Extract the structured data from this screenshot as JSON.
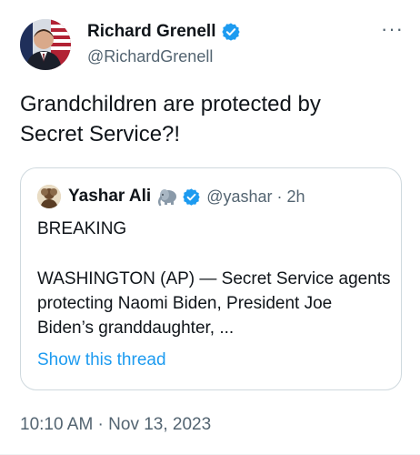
{
  "tweet": {
    "author_name": "Richard Grenell",
    "author_handle": "@RichardGrenell",
    "text": "Grandchildren are protected by Secret Service?!",
    "timestamp": "10:10 AM · Nov 13, 2023",
    "more_icon": "more-horizontal-icon"
  },
  "quote": {
    "author_name": "Yashar Ali",
    "author_handle": "@yashar",
    "separator": "·",
    "time": "2h",
    "breaking": "BREAKING",
    "body": "WASHINGTON (AP) — Secret Service agents protecting Naomi Biden, President Joe Biden’s granddaughter, ...",
    "show_thread": "Show this thread"
  },
  "colors": {
    "verified": "#1d9bf0",
    "link": "#1d9bf0",
    "secondary_text": "#536471",
    "border": "#cfd9de"
  }
}
